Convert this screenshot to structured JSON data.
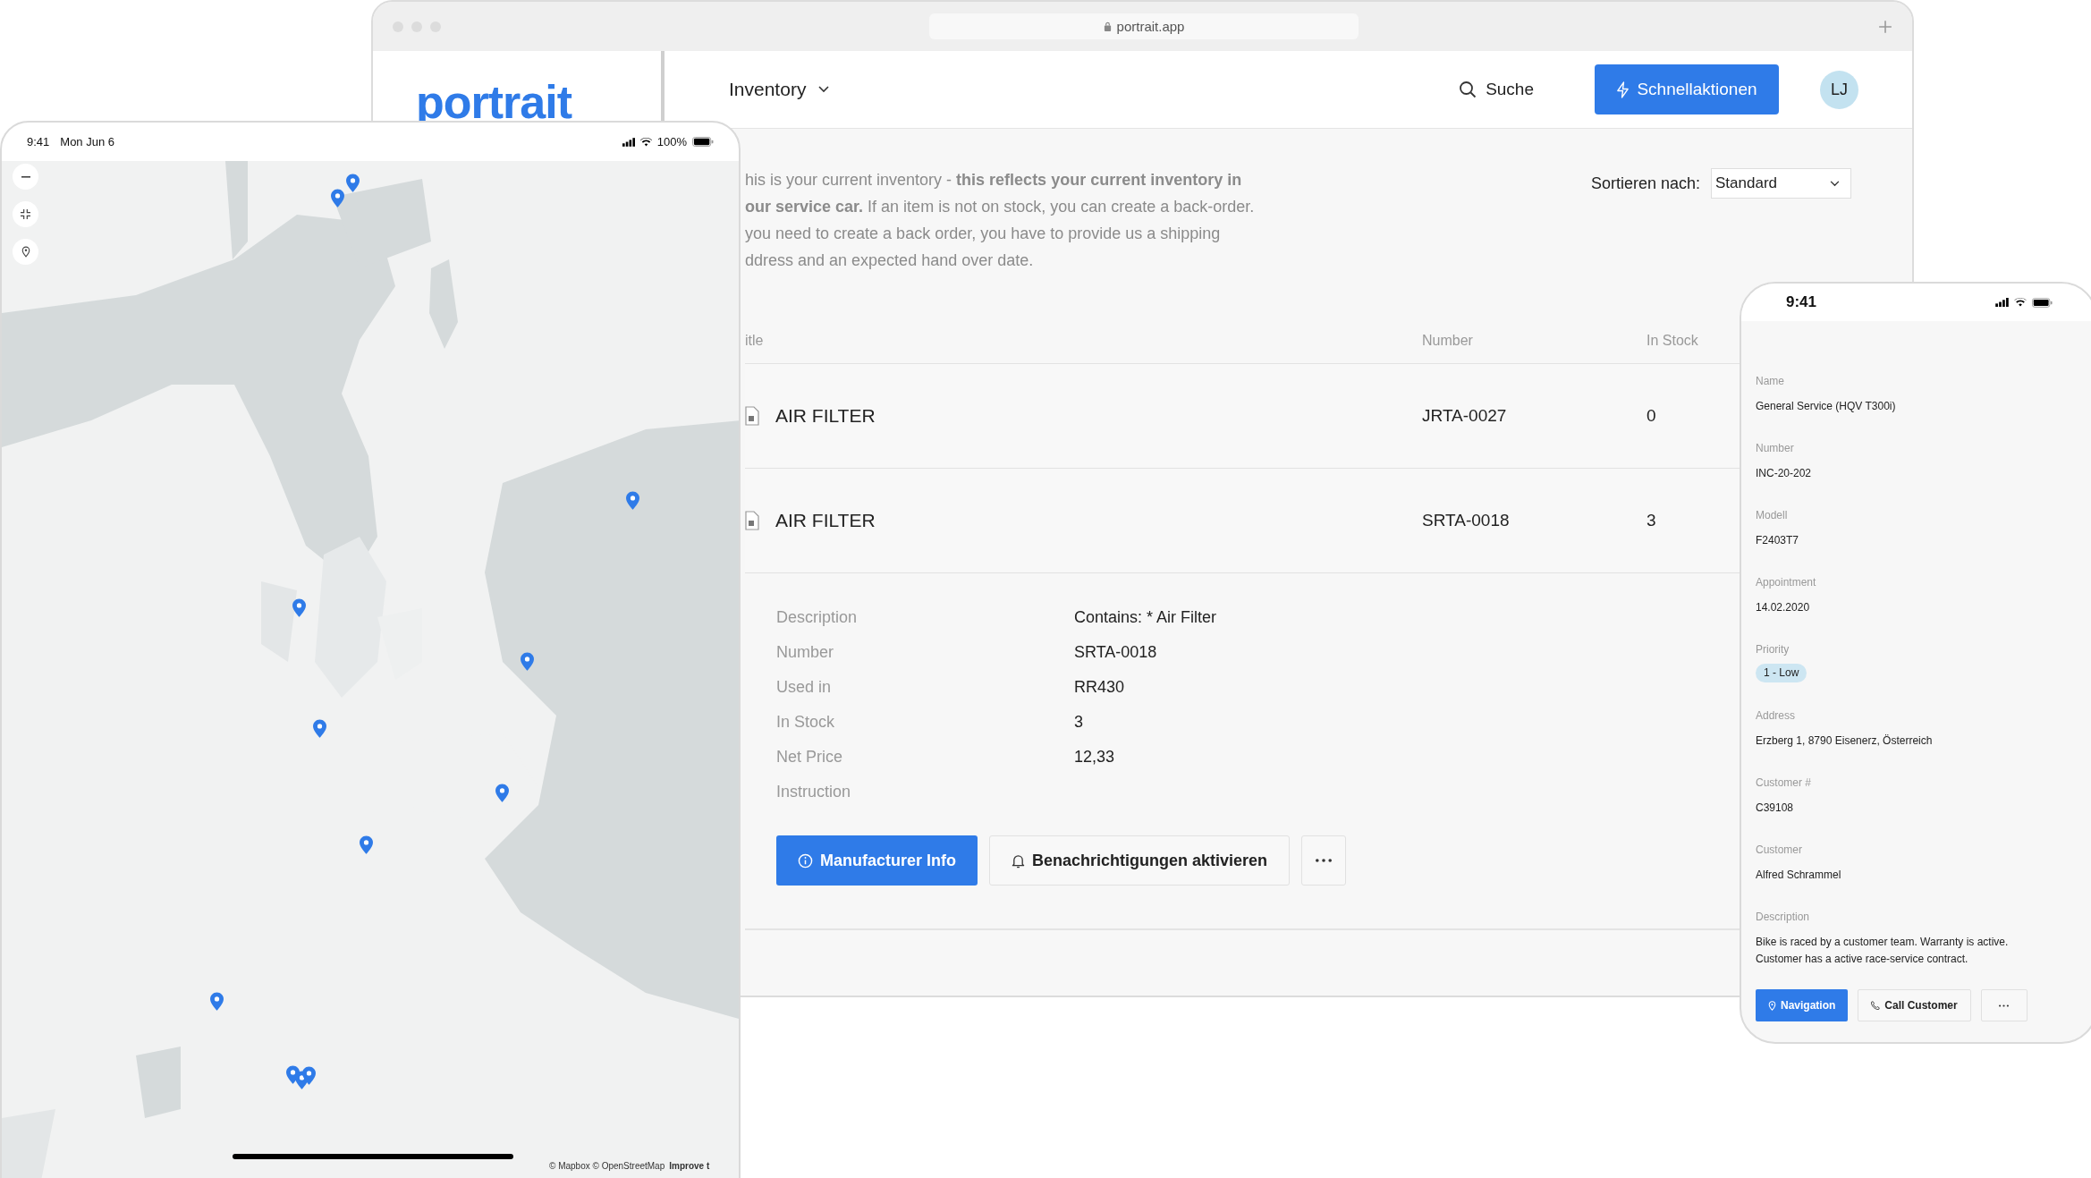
{
  "browser": {
    "url": "portrait.app",
    "logo": "portrait",
    "nav_title": "Inventory",
    "search_label": "Suche",
    "quick_action": "Schnellaktionen",
    "avatar": "LJ",
    "intro_lines": [
      "his is your current inventory - **this reflects your current inventory in**",
      "**our service car.** If an item is not on stock, you can create a back-order.",
      "you need to create a back order, you have to provide us a shipping",
      "ddress and an expected hand over date."
    ],
    "sort": {
      "label": "Sortieren nach:",
      "value": "Standard"
    },
    "table": {
      "columns": [
        "itle",
        "Number",
        "In Stock"
      ],
      "rows": [
        {
          "title": "AIR FILTER",
          "number": "JRTA-0027",
          "in_stock": "0"
        },
        {
          "title": "AIR FILTER",
          "number": "SRTA-0018",
          "in_stock": "3"
        }
      ]
    },
    "details": [
      {
        "label": "Description",
        "value": "Contains: * Air Filter"
      },
      {
        "label": "Number",
        "value": "SRTA-0018"
      },
      {
        "label": "Used in",
        "value": "RR430"
      },
      {
        "label": "In Stock",
        "value": "3"
      },
      {
        "label": "Net Price",
        "value": "12,33"
      },
      {
        "label": "Instruction"
      }
    ],
    "actions": [
      {
        "kind": "primary",
        "label": "Manufacturer Info"
      },
      {
        "kind": "secondary",
        "label": "Benachrichtigungen aktivieren"
      },
      {
        "kind": "more"
      }
    ]
  },
  "tablet": {
    "time": "9:41",
    "date": "Mon Jun 6",
    "battery": "100%",
    "map": {
      "kind": "picture",
      "attribution": "© Mapbox © OpenStreetMap",
      "improve": "Improve t"
    }
  },
  "phone": {
    "time": "9:41",
    "fields": [
      {
        "kind": "text",
        "label": "Name",
        "value": "General Service (HQV T300i)"
      },
      {
        "kind": "text",
        "label": "Number",
        "value": "INC-20-202"
      },
      {
        "kind": "text",
        "label": "Modell",
        "value": "F2403T7"
      },
      {
        "kind": "text",
        "label": "Appointment",
        "value": "14.02.2020"
      },
      {
        "kind": "tag",
        "label": "Priority",
        "value": "1 - Low",
        "color": "#cde6f2"
      },
      {
        "kind": "text",
        "label": "Address",
        "value": "Erzberg 1, 8790 Eisenerz, Österreich"
      },
      {
        "kind": "text",
        "label": "Customer #",
        "value": "C39108"
      },
      {
        "kind": "text",
        "label": "Customer",
        "value": "Alfred Schrammel"
      },
      {
        "kind": "text",
        "label": "Description",
        "value": "Bike is raced by a customer team. Warranty is active. Customer has a active race-service contract."
      }
    ],
    "actions": [
      {
        "kind": "primary",
        "label": "Navigation"
      },
      {
        "kind": "secondary",
        "label": "Call Customer"
      },
      {
        "kind": "more"
      }
    ]
  }
}
